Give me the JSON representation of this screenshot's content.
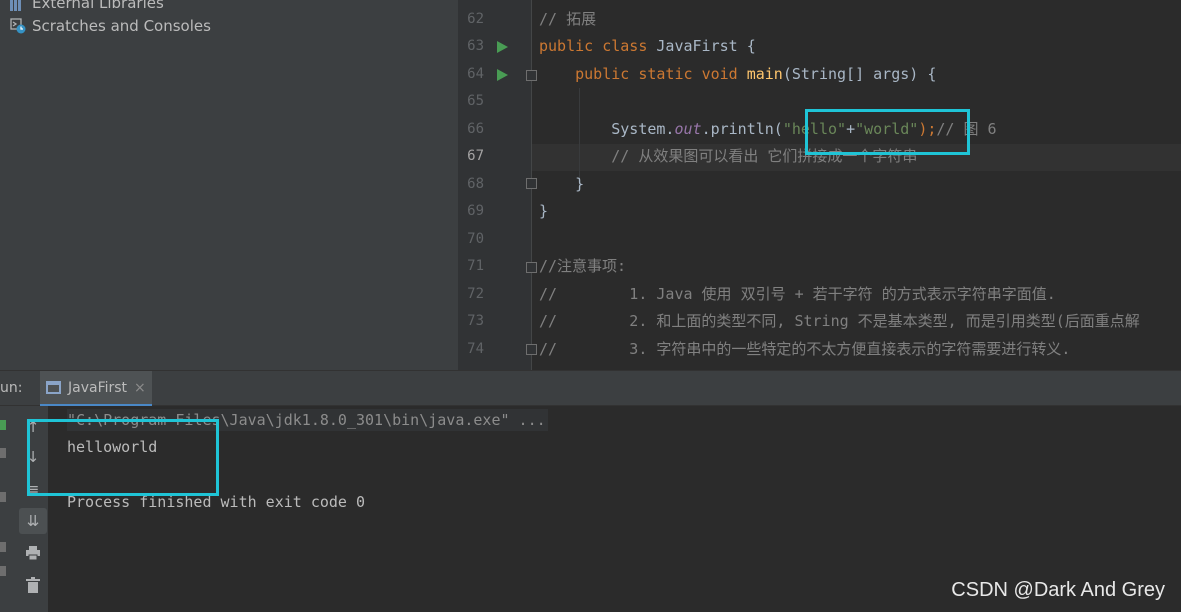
{
  "project": {
    "items": [
      {
        "label": "External Libraries",
        "icon": "library-icon"
      },
      {
        "label": "Scratches and Consoles",
        "icon": "scratches-icon"
      }
    ]
  },
  "editor": {
    "current_line": "67",
    "lines": [
      {
        "num": "62",
        "text": "// 拓展"
      },
      {
        "num": "63",
        "text": "public class JavaFirst {"
      },
      {
        "num": "64",
        "text": "    public static void main(String[] args) {"
      },
      {
        "num": "65",
        "text": ""
      },
      {
        "num": "66",
        "text": "        System.out.println(\"hello\"+\"world\");// 图 6"
      },
      {
        "num": "67",
        "text": "        // 从效果图可以看出 它们拼接成一个字符串"
      },
      {
        "num": "68",
        "text": "    }"
      },
      {
        "num": "69",
        "text": "}"
      },
      {
        "num": "70",
        "text": ""
      },
      {
        "num": "71",
        "text": "//注意事项:"
      },
      {
        "num": "72",
        "text": "//        1. Java 使用 双引号 + 若干字符 的方式表示字符串字面值."
      },
      {
        "num": "73",
        "text": "//        2. 和上面的类型不同, String 不是基本类型, 而是引用类型(后面重点解"
      },
      {
        "num": "74",
        "text": "//        3. 字符串中的一些特定的不太方便直接表示的字符需要进行转义."
      }
    ],
    "tokens": {
      "l62": "// 拓展",
      "l63_kw1": "public",
      "l63_kw2": "class",
      "l63_name": "JavaFirst {",
      "l64_kw1": "public",
      "l64_kw2": "static",
      "l64_kw3": "void",
      "l64_fn": "main",
      "l64_rest": "(String[] args) {",
      "l66_sys": "System.",
      "l66_out": "out",
      "l66_println": ".println(",
      "l66_str1": "\"hello\"",
      "l66_plus": "+",
      "l66_str2": "\"world\"",
      "l66_end": ");",
      "l66_cm": "// 图 6",
      "l67_cm": "// 从效果图可以看出 它们拼接成一个字符串",
      "l68": "}",
      "l69": "}",
      "l71_cm": "//注意事项:",
      "l72_cm": "//        1. Java 使用 双引号 + 若干字符 的方式表示字符串字面值.",
      "l73_cm": "//        2. 和上面的类型不同, String 不是基本类型, 而是引用类型(后面重点解",
      "l74_cm": "//        3. 字符串中的一些特定的不太方便直接表示的字符需要进行转义."
    }
  },
  "run": {
    "label": "un:",
    "tab_label": "JavaFirst",
    "tab_close": "×",
    "command": "\"C:\\Program Files\\Java\\jdk1.8.0_301\\bin\\java.exe\" ...",
    "output": "helloworld",
    "exit": "Process finished with exit code 0"
  },
  "watermark": "CSDN @Dark And Grey",
  "colors": {
    "annotation": "#1fc4d6",
    "keyword": "#cc7832",
    "string": "#6a8759",
    "comment": "#808080",
    "function": "#ffc66d",
    "run_arrow": "#499c54"
  }
}
